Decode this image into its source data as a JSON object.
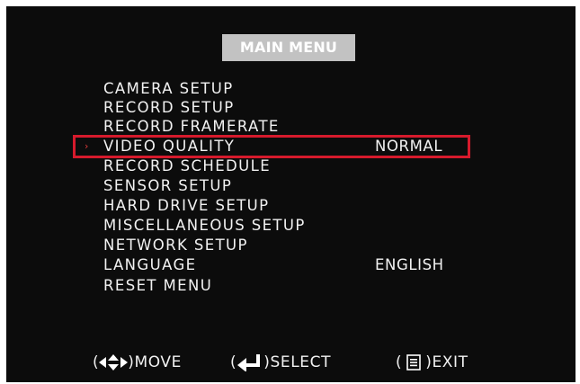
{
  "menu": {
    "title": "MAIN MENU",
    "items": [
      {
        "label": "CAMERA SETUP",
        "value": ""
      },
      {
        "label": "RECORD SETUP",
        "value": ""
      },
      {
        "label": "RECORD FRAMERATE",
        "value": ""
      },
      {
        "label": "VIDEO QUALITY",
        "value": "NORMAL",
        "selected": true
      },
      {
        "label": "RECORD SCHEDULE",
        "value": ""
      },
      {
        "label": "SENSOR SETUP",
        "value": ""
      },
      {
        "label": "HARD DRIVE SETUP",
        "value": ""
      },
      {
        "label": "MISCELLANEOUS SETUP",
        "value": ""
      },
      {
        "label": "NETWORK SETUP",
        "value": ""
      },
      {
        "label": "LANGUAGE",
        "value": "ENGLISH"
      },
      {
        "label": "RESET MENU",
        "value": ""
      }
    ],
    "cursor_glyph": "›",
    "selection_color": "#d61a2c"
  },
  "footer": {
    "move": {
      "icon": "four-arrows-icon",
      "label": "MOVE"
    },
    "select": {
      "icon": "enter-arrow-icon",
      "label": "SELECT"
    },
    "exit": {
      "icon": "menu-list-icon",
      "label": "EXIT"
    },
    "open_paren": "(",
    "close_paren": ")"
  }
}
